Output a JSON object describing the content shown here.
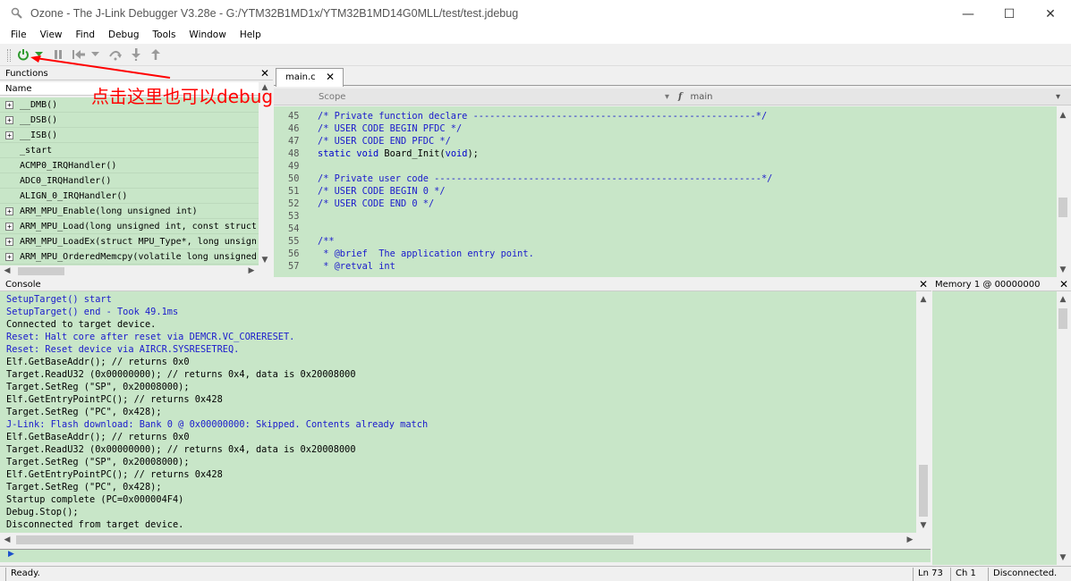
{
  "window": {
    "title": "Ozone - The J-Link Debugger V3.28e - G:/YTM32B1MD1x/YTM32B1MD14G0MLL/test/test.jdebug",
    "minimize": "—",
    "maximize": "☐",
    "close": "✕"
  },
  "menu": [
    "File",
    "View",
    "Find",
    "Debug",
    "Tools",
    "Window",
    "Help"
  ],
  "annotation": "点击这里也可以debug",
  "functions_panel": {
    "title": "Functions",
    "column": "Name",
    "items": [
      {
        "name": "__DMB()",
        "expandable": true
      },
      {
        "name": "__DSB()",
        "expandable": true
      },
      {
        "name": "__ISB()",
        "expandable": true
      },
      {
        "name": "_start",
        "expandable": false
      },
      {
        "name": "ACMP0_IRQHandler()",
        "expandable": false
      },
      {
        "name": "ADC0_IRQHandler()",
        "expandable": false
      },
      {
        "name": "ALIGN_0_IRQHandler()",
        "expandable": false
      },
      {
        "name": "ARM_MPU_Enable(long unsigned int)",
        "expandable": true
      },
      {
        "name": "ARM_MPU_Load(long unsigned int, const struct",
        "expandable": true
      },
      {
        "name": "ARM_MPU_LoadEx(struct MPU_Type*, long unsign",
        "expandable": true
      },
      {
        "name": "ARM_MPU_OrderedMemcpy(volatile long unsigned",
        "expandable": true
      }
    ]
  },
  "editor": {
    "tab": "main.c",
    "scope_placeholder": "Scope",
    "function_scope": "main",
    "lines": [
      {
        "n": "45",
        "text": "/* Private function declare ---------------------------------------------------*/",
        "cls": "cmt"
      },
      {
        "n": "46",
        "text": "/* USER CODE BEGIN PFDC */",
        "cls": "cmt"
      },
      {
        "n": "47",
        "text": "/* USER CODE END PFDC */",
        "cls": "cmt"
      },
      {
        "n": "48",
        "text": "static void Board_Init(void);",
        "cls": "mix"
      },
      {
        "n": "49",
        "text": "",
        "cls": ""
      },
      {
        "n": "50",
        "text": "/* Private user code -----------------------------------------------------------*/",
        "cls": "cmt"
      },
      {
        "n": "51",
        "text": "/* USER CODE BEGIN 0 */",
        "cls": "cmt"
      },
      {
        "n": "52",
        "text": "/* USER CODE END 0 */",
        "cls": "cmt"
      },
      {
        "n": "53",
        "text": "",
        "cls": ""
      },
      {
        "n": "54",
        "text": "",
        "cls": ""
      },
      {
        "n": "55",
        "text": "/**",
        "cls": "cmt"
      },
      {
        "n": "56",
        "text": " * @brief  The application entry point.",
        "cls": "cmt"
      },
      {
        "n": "57",
        "text": " * @retval int",
        "cls": "cmt"
      }
    ]
  },
  "console": {
    "title": "Console",
    "lines": [
      {
        "text": "SetupTarget() start",
        "blue": true
      },
      {
        "text": "SetupTarget() end - Took 49.1ms",
        "blue": true
      },
      {
        "text": "Connected to target device.",
        "blue": false
      },
      {
        "text": "Reset: Halt core after reset via DEMCR.VC_CORERESET.",
        "blue": true
      },
      {
        "text": "Reset: Reset device via AIRCR.SYSRESETREQ.",
        "blue": true
      },
      {
        "text": "Elf.GetBaseAddr(); // returns 0x0",
        "blue": false
      },
      {
        "text": "Target.ReadU32 (0x00000000); // returns 0x4, data is 0x20008000",
        "blue": false
      },
      {
        "text": "Target.SetReg (\"SP\", 0x20008000);",
        "blue": false
      },
      {
        "text": "Elf.GetEntryPointPC(); // returns 0x428",
        "blue": false
      },
      {
        "text": "Target.SetReg (\"PC\", 0x428);",
        "blue": false
      },
      {
        "text": "J-Link: Flash download: Bank 0 @ 0x00000000: Skipped. Contents already match",
        "blue": true
      },
      {
        "text": "Elf.GetBaseAddr(); // returns 0x0",
        "blue": false
      },
      {
        "text": "Target.ReadU32 (0x00000000); // returns 0x4, data is 0x20008000",
        "blue": false
      },
      {
        "text": "Target.SetReg (\"SP\", 0x20008000);",
        "blue": false
      },
      {
        "text": "Elf.GetEntryPointPC(); // returns 0x428",
        "blue": false
      },
      {
        "text": "Target.SetReg (\"PC\", 0x428);",
        "blue": false
      },
      {
        "text": "Startup complete (PC=0x000004F4)",
        "blue": false
      },
      {
        "text": "Debug.Stop();",
        "blue": false
      },
      {
        "text": "Disconnected from target device.",
        "blue": false
      }
    ]
  },
  "memory_panel": {
    "title": "Memory 1 @ 00000000"
  },
  "status": {
    "left": "Ready.",
    "line": "Ln 73",
    "col": "Ch 1",
    "connection": "Disconnected."
  },
  "colors": {
    "panel_bg": "#c8e6c8",
    "annotation": "#ff0000",
    "power_icon": "#2e9a2e"
  }
}
